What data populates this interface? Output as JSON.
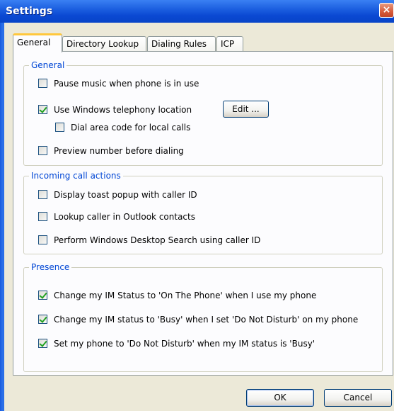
{
  "window": {
    "title": "Settings",
    "close_glyph": "×"
  },
  "tabs": [
    {
      "label": "General",
      "active": true
    },
    {
      "label": "Directory Lookup",
      "active": false
    },
    {
      "label": "Dialing Rules",
      "active": false
    },
    {
      "label": "ICP",
      "active": false
    }
  ],
  "groups": {
    "general": {
      "label": "General",
      "pause_music": {
        "label": "Pause music when phone is in use",
        "checked": false
      },
      "use_telephony": {
        "label": "Use Windows telephony location",
        "checked": true
      },
      "edit_button": "Edit ...",
      "dial_area_code": {
        "label": "Dial area code for local calls",
        "checked": false
      },
      "preview_number": {
        "label": "Preview number before dialing",
        "checked": false
      }
    },
    "incoming": {
      "label": "Incoming call actions",
      "toast_popup": {
        "label": "Display toast popup with caller ID",
        "checked": false
      },
      "lookup_outlook": {
        "label": "Lookup caller in Outlook contacts",
        "checked": false
      },
      "desktop_search": {
        "label": "Perform Windows Desktop Search using caller ID",
        "checked": false
      }
    },
    "presence": {
      "label": "Presence",
      "on_the_phone": {
        "label": "Change my IM Status to 'On The Phone' when I use my phone",
        "checked": true
      },
      "busy_dnd": {
        "label": "Change my IM status to 'Busy' when I set 'Do Not Disturb' on my phone",
        "checked": true
      },
      "dnd_busy": {
        "label": "Set my phone to 'Do Not Disturb' when my IM status is 'Busy'",
        "checked": true
      }
    }
  },
  "buttons": {
    "ok": "OK",
    "cancel": "Cancel"
  }
}
